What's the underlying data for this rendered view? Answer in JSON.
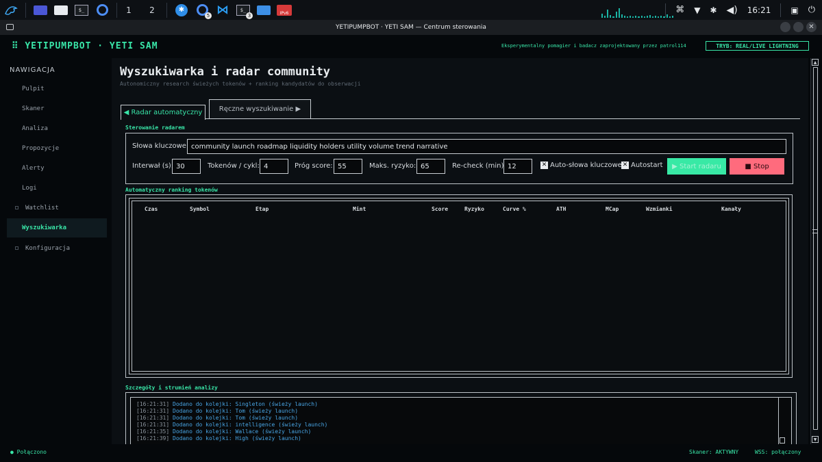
{
  "taskbar": {
    "workspaces": [
      "1",
      "2"
    ],
    "badge_5": "5",
    "badge_3": "3",
    "ipv6_label": "IPv6",
    "clock": "16:21",
    "terminal_glyph": "$_"
  },
  "window": {
    "title": "YETIPUMPBOT · YETI SAM — Centrum sterowania"
  },
  "header": {
    "brand": "⠿ YETIPUMPBOT · YETI SAM",
    "description": "Eksperymentalny pomagier i badacz zaprojektowany przez patrol114",
    "mode": "TRYB: REAL/LIVE LIGHTNING"
  },
  "sidebar": {
    "title": "NAWIGACJA",
    "items": [
      {
        "label": "Pulpit"
      },
      {
        "label": "Skaner"
      },
      {
        "label": "Analiza"
      },
      {
        "label": "Propozycje"
      },
      {
        "label": "Alerty"
      },
      {
        "label": "Logi"
      },
      {
        "label": "Watchlist"
      },
      {
        "label": "Wyszukiwarka"
      },
      {
        "label": "Konfiguracja"
      }
    ]
  },
  "main": {
    "title": "Wyszukiwarka i radar community",
    "subtitle": "Autonomiczny research świeżych tokenów + ranking kandydatów do obserwacji",
    "tabs": [
      {
        "label": "◀ Radar automatyczny"
      },
      {
        "label": "Ręczne wyszukiwanie ▶"
      }
    ]
  },
  "radar": {
    "section": "Sterowanie radarem",
    "keywords_label": "Słowa kluczowe:",
    "keywords_value": "community launch roadmap liquidity holders utility volume trend narrative",
    "interval_label": "Interwał (s):",
    "interval_value": "30",
    "tokens_label": "Tokenów / cykl:",
    "tokens_value": "4",
    "score_label": "Próg score:",
    "score_value": "55",
    "risk_label": "Maks. ryzyko:",
    "risk_value": "65",
    "recheck_label": "Re-check (min):",
    "recheck_value": "12",
    "auto_keywords_label": "Auto-słowa kluczowe",
    "autostart_label": "Autostart",
    "start_label": "▶ Start radaru",
    "stop_label": "■ Stop",
    "check_mark": "✕"
  },
  "ranking": {
    "section": "Automatyczny ranking tokenów",
    "columns": [
      "Czas",
      "Symbol",
      "Etap",
      "Mint",
      "Score",
      "Ryzyko",
      "Curve %",
      "ATH",
      "MCap",
      "Wzmianki",
      "Kanały"
    ],
    "rows": []
  },
  "stream": {
    "section": "Szczegóły i strumień analizy",
    "lines": [
      {
        "ts": "[16:21:31]",
        "msg": "Dodano do kolejki: Singleton (świeży launch)"
      },
      {
        "ts": "[16:21:31]",
        "msg": "Dodano do kolejki: Tom (świeży launch)"
      },
      {
        "ts": "[16:21:31]",
        "msg": "Dodano do kolejki: Tom (świeży launch)"
      },
      {
        "ts": "[16:21:31]",
        "msg": "Dodano do kolejki: intelligence (świeży launch)"
      },
      {
        "ts": "[16:21:35]",
        "msg": "Dodano do kolejki: Wallace (świeży launch)"
      },
      {
        "ts": "[16:21:39]",
        "msg": "Dodano do kolejki: High (świeży launch)"
      }
    ]
  },
  "status": {
    "connection": "● Połączono",
    "scanner": "Skaner: AKTYWNY",
    "wss": "WSS: połączony"
  },
  "colors": {
    "accent": "#39e6a8",
    "stop": "#ff6b7d",
    "log": "#49a6e6"
  }
}
